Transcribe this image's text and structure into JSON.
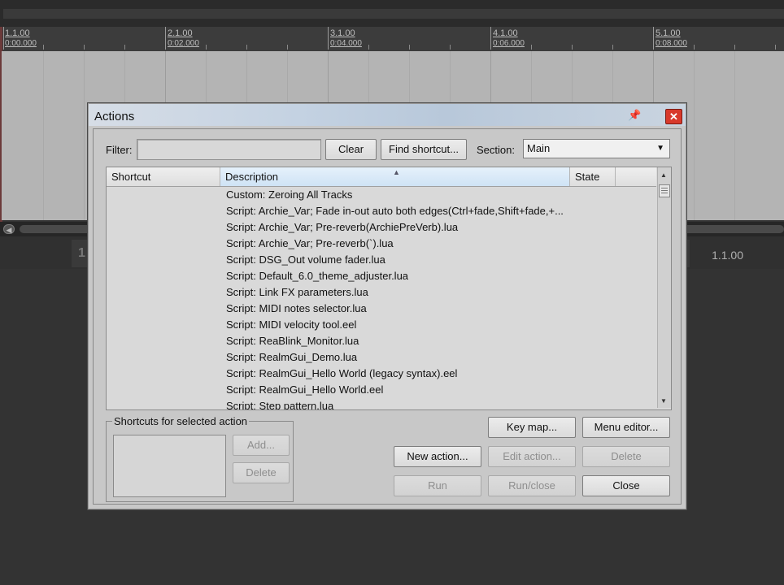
{
  "daw": {
    "ruler": [
      {
        "measure": "1.1.00",
        "time": "0:00.000"
      },
      {
        "measure": "2.1.00",
        "time": "0:02.000"
      },
      {
        "measure": "3.1.00",
        "time": "0:04.000"
      },
      {
        "measure": "4.1.00",
        "time": "0:06.000"
      },
      {
        "measure": "5.1.00",
        "time": "0:08.000"
      }
    ],
    "transport_position": "1.1.00"
  },
  "dialog": {
    "title": "Actions",
    "filter_label": "Filter:",
    "filter_value": "",
    "clear_label": "Clear",
    "find_shortcut_label": "Find shortcut...",
    "section_label": "Section:",
    "section_value": "Main",
    "columns": {
      "shortcut": "Shortcut",
      "description": "Description",
      "state": "State"
    },
    "actions": [
      {
        "shortcut": "",
        "description": "Custom: Zeroing All Tracks",
        "state": ""
      },
      {
        "shortcut": "",
        "description": "Script: Archie_Var; Fade in-out auto both edges(Ctrl+fade,Shift+fade,+...",
        "state": ""
      },
      {
        "shortcut": "",
        "description": "Script: Archie_Var; Pre-reverb(ArchiePreVerb).lua",
        "state": ""
      },
      {
        "shortcut": "",
        "description": "Script: Archie_Var; Pre-reverb(`).lua",
        "state": ""
      },
      {
        "shortcut": "",
        "description": "Script: DSG_Out volume fader.lua",
        "state": ""
      },
      {
        "shortcut": "",
        "description": "Script: Default_6.0_theme_adjuster.lua",
        "state": ""
      },
      {
        "shortcut": "",
        "description": "Script: Link FX parameters.lua",
        "state": ""
      },
      {
        "shortcut": "",
        "description": "Script: MIDI notes selector.lua",
        "state": ""
      },
      {
        "shortcut": "",
        "description": "Script: MIDI velocity tool.eel",
        "state": ""
      },
      {
        "shortcut": "",
        "description": "Script: ReaBlink_Monitor.lua",
        "state": ""
      },
      {
        "shortcut": "",
        "description": "Script: RealmGui_Demo.lua",
        "state": ""
      },
      {
        "shortcut": "",
        "description": "Script: RealmGui_Hello World (legacy syntax).eel",
        "state": ""
      },
      {
        "shortcut": "",
        "description": "Script: RealmGui_Hello World.eel",
        "state": ""
      },
      {
        "shortcut": "",
        "description": "Script: Step pattern.lua",
        "state": ""
      }
    ],
    "shortcuts_group_title": "Shortcuts for selected action",
    "add_label": "Add...",
    "delete_shortcut_label": "Delete",
    "key_map_label": "Key map...",
    "menu_editor_label": "Menu editor...",
    "new_action_label": "New action...",
    "edit_action_label": "Edit action...",
    "delete_action_label": "Delete",
    "run_label": "Run",
    "run_close_label": "Run/close",
    "close_label": "Close"
  }
}
